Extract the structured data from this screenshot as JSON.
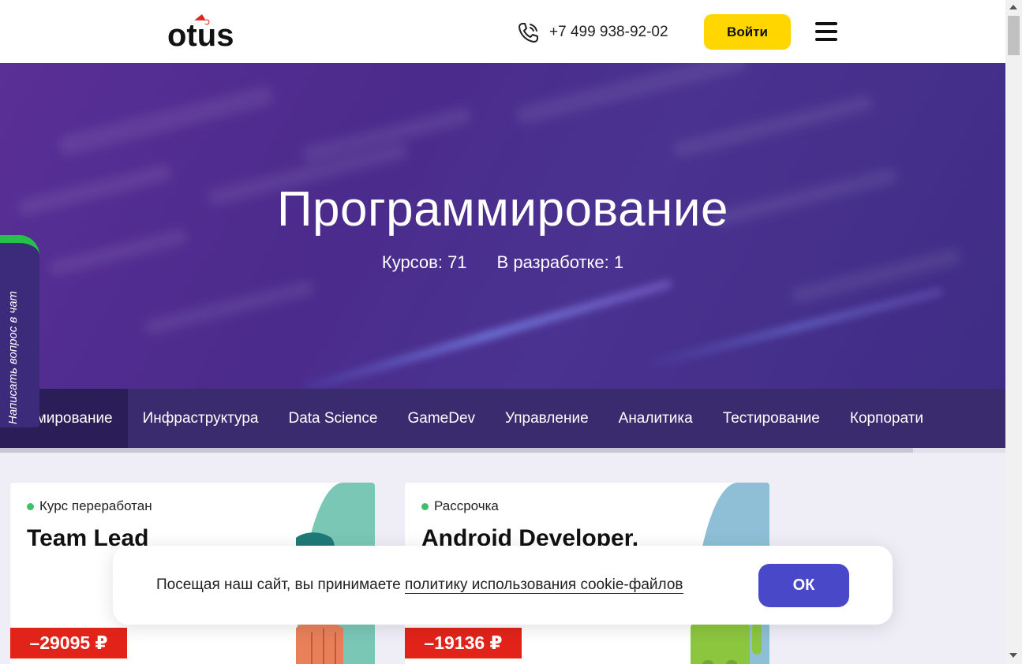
{
  "header": {
    "logo_text": "otus",
    "phone": "+7 499 938-92-02",
    "login_label": "Войти"
  },
  "hero": {
    "title": "Программирование",
    "courses": "Курсов: 71",
    "in_development": "В разработке: 1"
  },
  "tabs": [
    {
      "label": "ограммирование",
      "active": true
    },
    {
      "label": "Инфраструктура"
    },
    {
      "label": "Data Science"
    },
    {
      "label": "GameDev"
    },
    {
      "label": "Управление"
    },
    {
      "label": "Аналитика"
    },
    {
      "label": "Тестирование"
    },
    {
      "label": "Корпорати"
    }
  ],
  "chat": {
    "label": "Написать вопрос в чат",
    "accent": "#25c24a"
  },
  "cards": [
    {
      "tag": "Курс переработан",
      "title": "Team Lead",
      "price": "–29095 ₽",
      "art_color": "#7ac7b6"
    },
    {
      "tag": "Рассрочка",
      "title": "Android Developer.",
      "price": "–19136 ₽",
      "art_color": "#8ebfd6"
    }
  ],
  "cookie": {
    "text": "Посещая наш сайт, вы принимаете ",
    "link": "политику использования cookie-файлов",
    "ok_label": "ОК"
  },
  "colors": {
    "brand_yellow": "#ffd600",
    "hero_purple": "#4b2b8c",
    "price_red": "#e2231a",
    "ok_button": "#4848c8"
  }
}
